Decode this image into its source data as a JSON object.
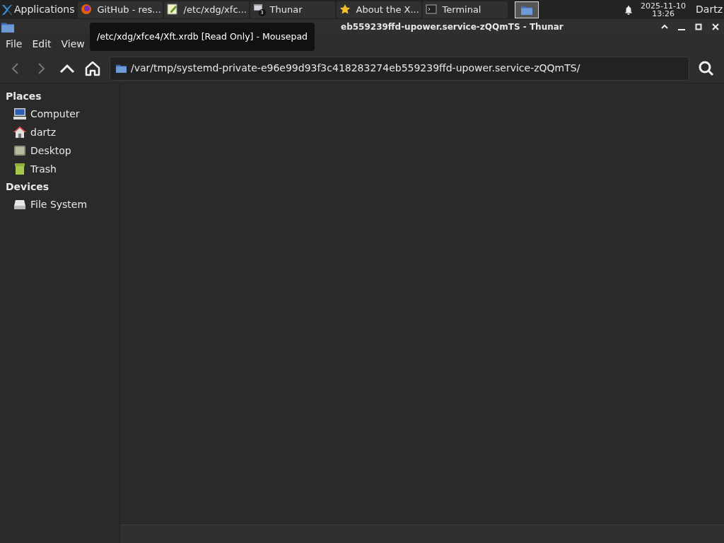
{
  "panel": {
    "applications": "Applications",
    "tasks": [
      {
        "label": "GitHub - res...",
        "kind": "browser",
        "selected": false
      },
      {
        "label": "/etc/xdg/xfc...",
        "kind": "editor",
        "selected": false
      },
      {
        "label": "Thunar",
        "kind": "windows",
        "badge": "3",
        "selected": false
      },
      {
        "label": "About the X...",
        "kind": "star",
        "selected": false
      },
      {
        "label": "Terminal",
        "kind": "terminal",
        "selected": false
      }
    ],
    "launcher": {
      "selected": true
    },
    "date": "2025-11-10",
    "time": "13:26",
    "user": "Dartz"
  },
  "tooltip": "/etc/xdg/xfce4/Xft.xrdb [Read Only] - Mousepad",
  "window": {
    "title": "eb559239ffd-upower.service-zQQmTS - Thunar"
  },
  "menu": [
    "File",
    "Edit",
    "View"
  ],
  "location": "/var/tmp/systemd-private-e96e99d93f3c418283274eb559239ffd-upower.service-zQQmTS/",
  "sidebar": [
    {
      "heading": "Places",
      "items": [
        {
          "label": "Computer",
          "kind": "computer"
        },
        {
          "label": "dartz",
          "kind": "home"
        },
        {
          "label": "Desktop",
          "kind": "desktop"
        },
        {
          "label": "Trash",
          "kind": "trash"
        }
      ]
    },
    {
      "heading": "Devices",
      "items": [
        {
          "label": "File System",
          "kind": "drive"
        }
      ]
    }
  ]
}
